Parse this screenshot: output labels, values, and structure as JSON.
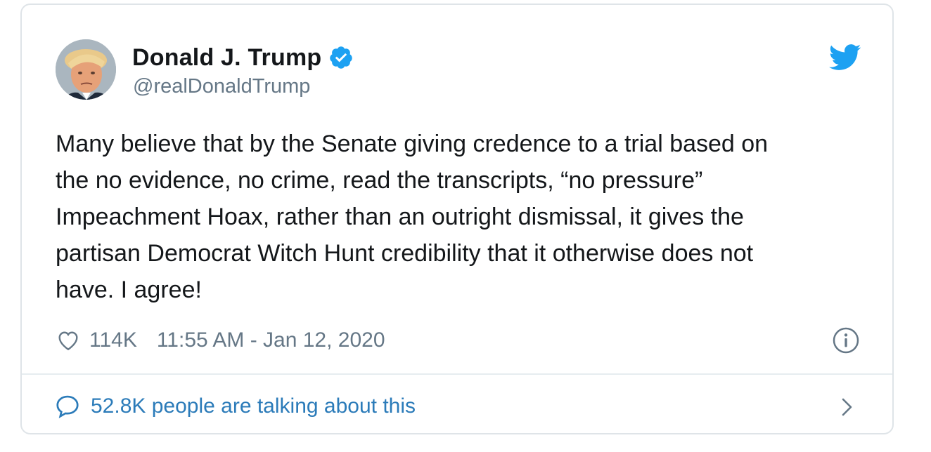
{
  "colors": {
    "text": "#14171a",
    "secondary": "#657786",
    "link": "#2b7bb9",
    "verified": "#1da1f2",
    "twitter_blue": "#1da1f2",
    "border": "#dfe4e8"
  },
  "tweet": {
    "author": {
      "display_name": "Donald J. Trump",
      "handle": "@realDonaldTrump",
      "verified": true,
      "avatar": "profile-photo"
    },
    "text": "Many believe that by the Senate giving credence to a trial based on\nthe no evidence, no crime, read the transcripts, “no pressure”\nImpeachment Hoax, rather than an outright dismissal, it gives the\npartisan Democrat Witch Hunt credibility that it otherwise does not\nhave. I agree!",
    "likes": "114K",
    "timestamp": "11:55 AM - Jan 12, 2020",
    "conversation": "52.8K people are talking about this"
  },
  "icons": {
    "verified": "verified-badge-icon",
    "logo": "twitter-bird-icon",
    "like": "heart-icon",
    "info": "info-icon",
    "reply": "speech-bubble-icon",
    "more": "chevron-right-icon"
  }
}
